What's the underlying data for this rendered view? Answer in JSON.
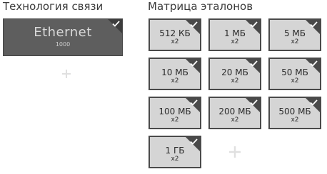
{
  "sections": {
    "technology_title": "Технология связи",
    "matrix_title": "Матрица эталонов"
  },
  "ethernet": {
    "name": "Ethernet",
    "speed": "1000",
    "selected": true
  },
  "matrix": {
    "tiles": [
      {
        "size": "512 КБ",
        "mult": "x2",
        "selected": true
      },
      {
        "size": "1 МБ",
        "mult": "x2",
        "selected": true
      },
      {
        "size": "5 МБ",
        "mult": "x2",
        "selected": true
      },
      {
        "size": "10 МБ",
        "mult": "x2",
        "selected": true
      },
      {
        "size": "20 МБ",
        "mult": "x2",
        "selected": true
      },
      {
        "size": "50 МБ",
        "mult": "x2",
        "selected": true
      },
      {
        "size": "100 МБ",
        "mult": "x2",
        "selected": true
      },
      {
        "size": "200 МБ",
        "mult": "x2",
        "selected": true
      },
      {
        "size": "500 МБ",
        "mult": "x2",
        "selected": true
      },
      {
        "size": "1 ГБ",
        "mult": "x2",
        "selected": true
      }
    ]
  },
  "icons": {
    "check": "check-icon",
    "add": "plus-icon"
  }
}
